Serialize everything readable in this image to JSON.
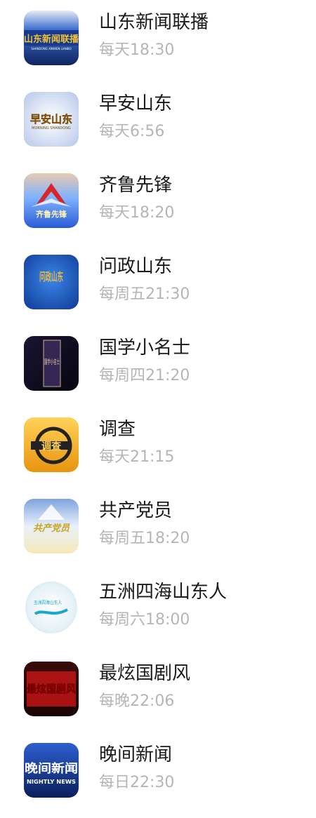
{
  "programs": [
    {
      "title": "山东新闻联播",
      "schedule": "每天18:30",
      "logo_text": "山东新闻联播",
      "logo_sub": "SHANDONG XINWEN LIANBO",
      "colors": [
        "#1d3a8a",
        "#3b6fd0",
        "#e8b830"
      ]
    },
    {
      "title": "早安山东",
      "schedule": "每天6:56",
      "logo_text": "早安山东",
      "logo_sub": "MORNING SHANDONG",
      "colors": [
        "#dfe7f5",
        "#b8c8ea",
        "#d99a1e"
      ]
    },
    {
      "title": "齐鲁先锋",
      "schedule": "每天18:20",
      "logo_text": "齐鲁先锋",
      "colors": [
        "#2a5bd7",
        "#7fb2ff",
        "#d6262a"
      ]
    },
    {
      "title": "问政山东",
      "schedule": "每周五21:30",
      "logo_text": "问政山东",
      "colors": [
        "#1b55c2",
        "#3a86e8",
        "#f0b93a"
      ]
    },
    {
      "title": "国学小名士",
      "schedule": "每周四21:20",
      "logo_text": "国学小名士",
      "colors": [
        "#0e0b1f",
        "#3a2a5a",
        "#e9d6a6"
      ]
    },
    {
      "title": "调查",
      "schedule": "每天21:15",
      "logo_text": "调查",
      "colors": [
        "#f2a51a",
        "#ffd25a",
        "#222222"
      ]
    },
    {
      "title": "共产党员",
      "schedule": "每周五18:20",
      "logo_text": "共产党员",
      "colors": [
        "#e9f0fb",
        "#9fb9e6",
        "#c8a21a"
      ]
    },
    {
      "title": "五洲四海山东人",
      "schedule": "每周六18:00",
      "logo_text": "五洲四海山东人",
      "colors": [
        "#ffffff",
        "#cfe6f2",
        "#1aa8c9"
      ]
    },
    {
      "title": "最炫国剧风",
      "schedule": "每晚22:06",
      "logo_text": "最炫国剧风",
      "colors": [
        "#3a0b0b",
        "#c21515",
        "#ffcc00"
      ]
    },
    {
      "title": "晚间新闻",
      "schedule": "每日22:30",
      "logo_text": "晚间新闻",
      "logo_sub": "NIGHTLY NEWS",
      "colors": [
        "#0a1f5c",
        "#2d5fd0",
        "#ffffff"
      ]
    }
  ]
}
